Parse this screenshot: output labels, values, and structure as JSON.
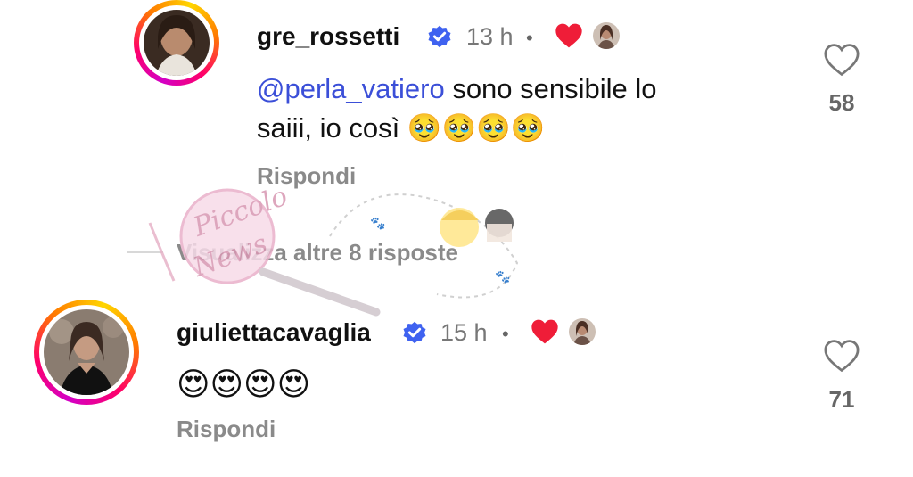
{
  "comments": [
    {
      "username": "gre_rossetti",
      "time": "13 h",
      "separator": "•",
      "mention": "@perla_vatiero",
      "text_line1": " sono sensibile lo",
      "text_line2": "saiii, io così ",
      "emojis": "🥹🥹🥹🥹",
      "reply_label": "Rispondi",
      "likes": "58"
    },
    {
      "username": "giuliettacavaglia",
      "time": "15 h",
      "separator": "•",
      "emojis": "😍😍😍😍",
      "reply_label": "Rispondi",
      "likes": "71"
    }
  ],
  "view_more_replies": "Visualizza altre 8 risposte",
  "watermark": "Piccolo News",
  "icons": {
    "verified": "verified-badge-icon",
    "heart_outline": "heart-outline-icon",
    "creator_liked": "red-heart-icon"
  },
  "colors": {
    "verified_blue": "#3f62f0",
    "liked_red": "#ef1d38",
    "mention_blue": "#3b4fd8",
    "secondary_text": "#8a8a8a"
  }
}
